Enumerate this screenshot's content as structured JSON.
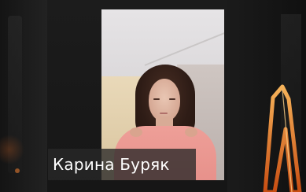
{
  "participant": {
    "name": "Карина Буряк"
  },
  "colors": {
    "background": "#1a1a1a",
    "label_background": "rgba(40,40,40,0.78)",
    "label_text": "#ffffff",
    "accent_glow": "#e07a2c"
  }
}
